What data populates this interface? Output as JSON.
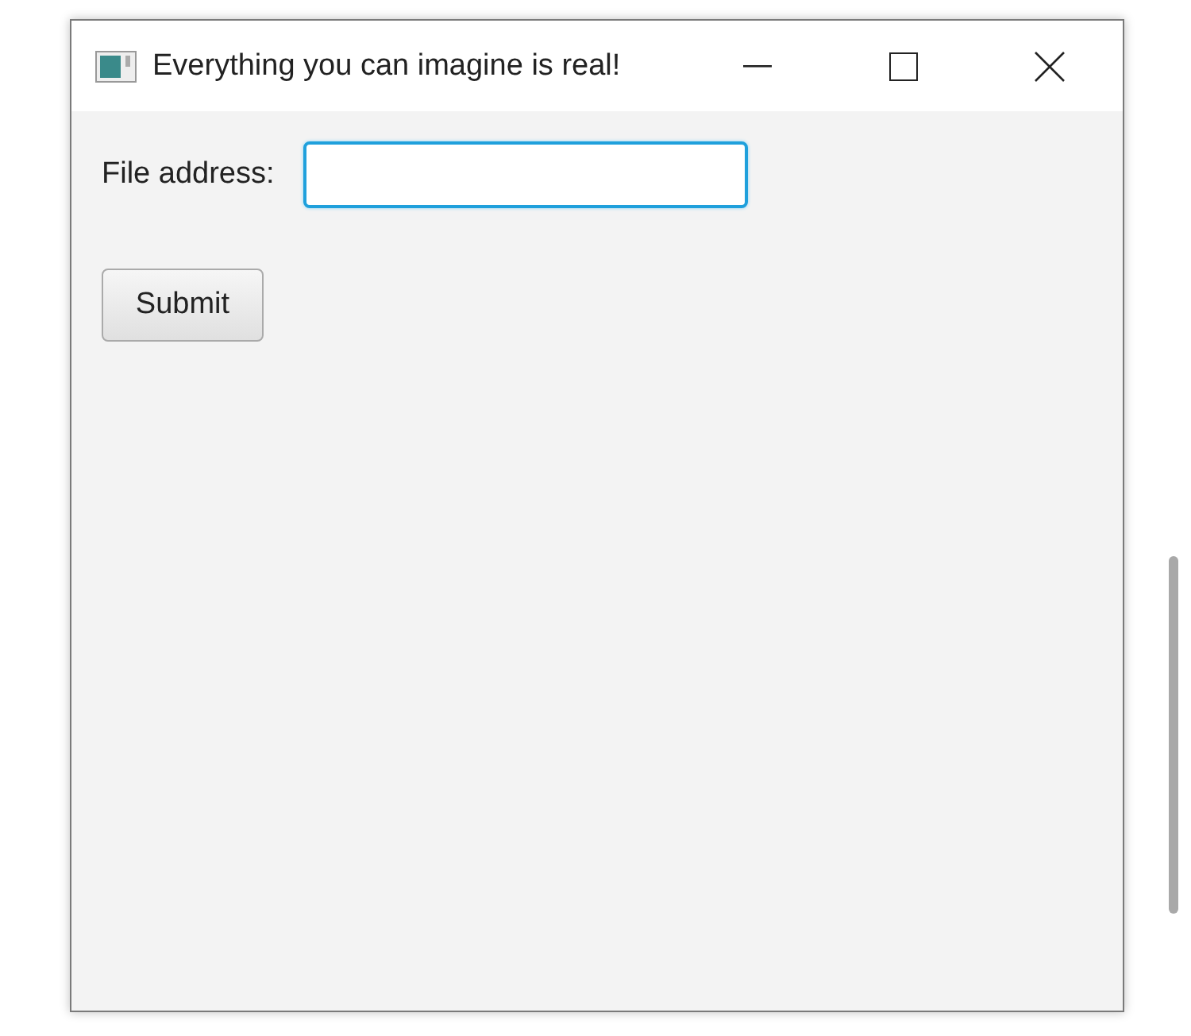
{
  "window": {
    "title": "Everything you can imagine is real!"
  },
  "form": {
    "label": "File address:",
    "field": {
      "focused": true
    },
    "button": "Submit"
  }
}
